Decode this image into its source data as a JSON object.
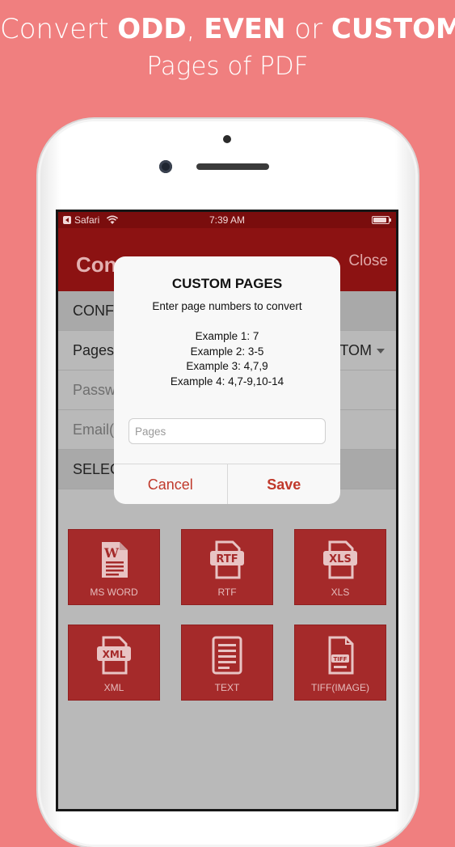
{
  "headline": {
    "line1_part1": "Convert ",
    "line1_bold1": "ODD",
    "line1_part2": ", ",
    "line1_bold2": "EVEN",
    "line1_part3": " or ",
    "line1_bold3": "CUSTOM",
    "line2": "Pages of PDF"
  },
  "statusbar": {
    "back_app": "Safari",
    "time": "7:39 AM"
  },
  "navbar": {
    "title": "Con",
    "close_label": "Close"
  },
  "form": {
    "rows": [
      {
        "label": "CONF"
      },
      {
        "label": "Pages",
        "value": "TOM"
      },
      {
        "placeholder": "Passw"
      },
      {
        "placeholder": "Email("
      },
      {
        "label": "SELEC"
      }
    ]
  },
  "formats": [
    {
      "label": "MS WORD",
      "icon": "word-document-icon",
      "badge": "W"
    },
    {
      "label": "RTF",
      "icon": "rtf-file-icon",
      "badge": "RTF"
    },
    {
      "label": "XLS",
      "icon": "xls-file-icon",
      "badge": "XLS"
    },
    {
      "label": "XML",
      "icon": "xml-file-icon",
      "badge": "XML"
    },
    {
      "label": "TEXT",
      "icon": "text-document-icon",
      "badge": ""
    },
    {
      "label": "TIFF(IMAGE)",
      "icon": "tiff-image-icon",
      "badge": "TIFF"
    }
  ],
  "dialog": {
    "title": "CUSTOM PAGES",
    "message": "Enter page numbers to convert",
    "examples": [
      "Example 1: 7",
      "Example 2: 3-5",
      "Example 3: 4,7,9",
      "Example 4: 4,7-9,10-14"
    ],
    "input_placeholder": "Pages",
    "input_value": "",
    "cancel_label": "Cancel",
    "save_label": "Save"
  },
  "colors": {
    "background": "#f07f7f",
    "navbar": "#8c1212",
    "tile": "#a52a2a",
    "accent": "#c0392b"
  }
}
